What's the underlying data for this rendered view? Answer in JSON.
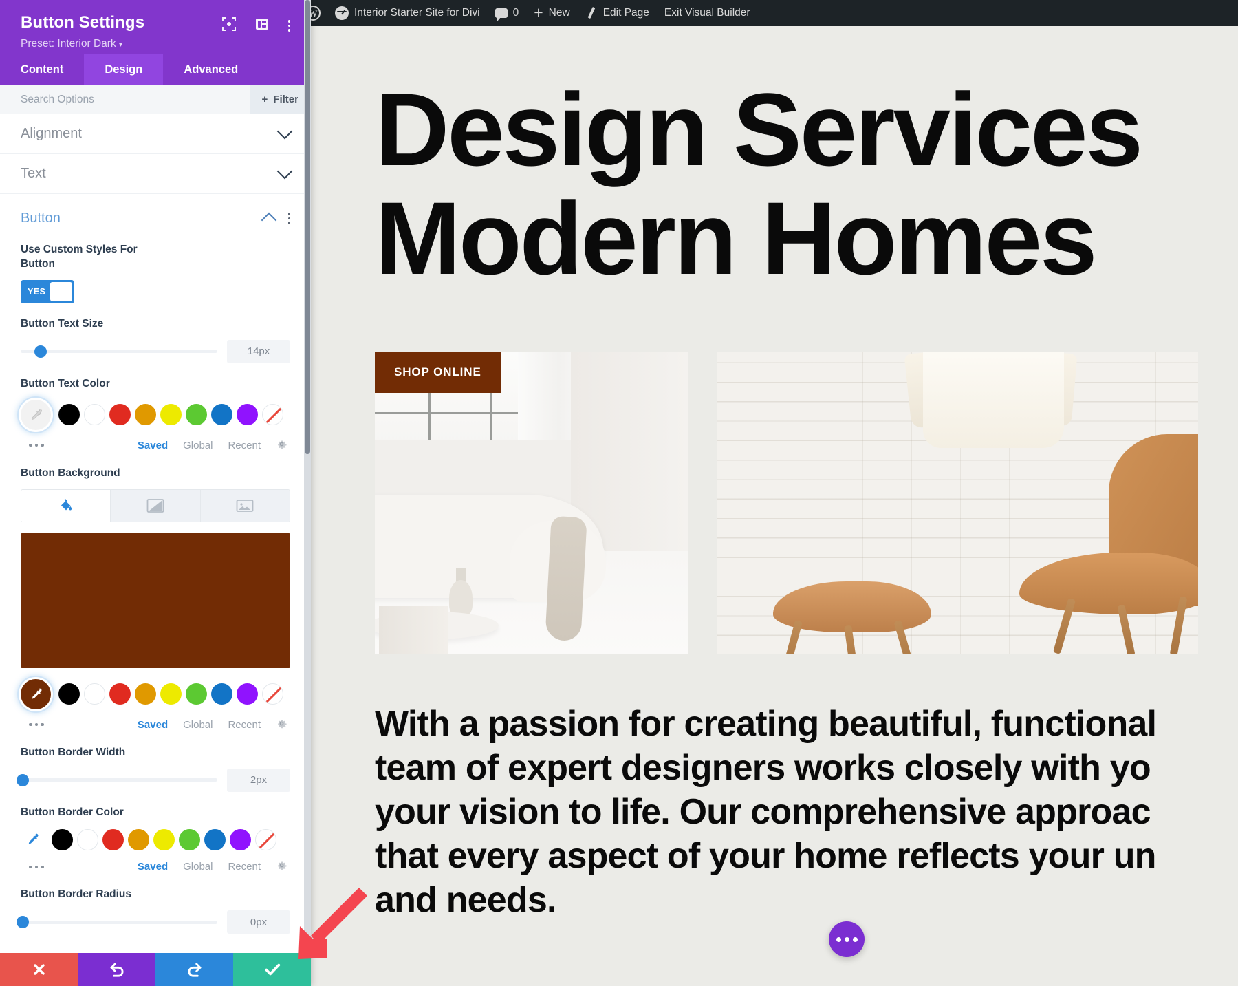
{
  "adminbar": {
    "site_name": "Interior Starter Site for Divi",
    "comment_count": "0",
    "new_label": "New",
    "edit_page_label": "Edit Page",
    "exit_label": "Exit Visual Builder"
  },
  "panel": {
    "title": "Button Settings",
    "preset_label": "Preset: Interior Dark",
    "preset_caret": "▾",
    "tabs": [
      {
        "label": "Content",
        "active": false
      },
      {
        "label": "Design",
        "active": true
      },
      {
        "label": "Advanced",
        "active": false
      }
    ],
    "search_placeholder": "Search Options",
    "search_value": "",
    "filter_label": "Filter",
    "filter_plus": "+",
    "sections": {
      "alignment": "Alignment",
      "text": "Text",
      "button": "Button"
    },
    "fields": {
      "use_custom_styles": {
        "label": "Use Custom Styles For Button",
        "toggle_value": "YES"
      },
      "button_text_size": {
        "label": "Button Text Size",
        "value": "14px",
        "knob_percent": 10
      },
      "button_text_color": {
        "label": "Button Text Color",
        "selected_color": "#f2f2f2",
        "swatches": [
          "#000000",
          "#ffffff",
          "#e02b20",
          "#e09900",
          "#edea00",
          "#5cc932",
          "#1274c6",
          "#9013fe",
          "none"
        ],
        "meta": {
          "saved": "Saved",
          "global": "Global",
          "recent": "Recent"
        }
      },
      "button_background": {
        "label": "Button Background",
        "types": [
          "color-fill-icon",
          "gradient-icon",
          "image-icon"
        ],
        "active_type": 0,
        "preview_color": "#722c05",
        "selected_color": "#722c05",
        "swatches": [
          "#000000",
          "#ffffff",
          "#e02b20",
          "#e09900",
          "#edea00",
          "#5cc932",
          "#1274c6",
          "#9013fe",
          "none"
        ],
        "meta": {
          "saved": "Saved",
          "global": "Global",
          "recent": "Recent"
        }
      },
      "button_border_width": {
        "label": "Button Border Width",
        "value": "2px",
        "knob_percent": 1
      },
      "button_border_color": {
        "label": "Button Border Color",
        "swatches": [
          "#000000",
          "#ffffff",
          "#e02b20",
          "#e09900",
          "#edea00",
          "#5cc932",
          "#1274c6",
          "#9013fe",
          "none"
        ],
        "meta": {
          "saved": "Saved",
          "global": "Global",
          "recent": "Recent"
        }
      },
      "button_border_radius": {
        "label": "Button Border Radius",
        "value": "0px",
        "knob_percent": 1
      }
    },
    "actions": {
      "cancel": "✕",
      "undo": "↺",
      "redo": "↻",
      "save": "✓"
    },
    "header_icons": [
      "fullscreen-icon",
      "layout-icon",
      "kebab-menu-icon"
    ]
  },
  "page": {
    "hero_title_line1": "Design Services",
    "hero_title_line2": "Modern Homes",
    "shop_badge": "SHOP ONLINE",
    "body_lines": [
      "With a passion for creating beautiful, functional",
      "team of expert designers works closely with yo",
      "your vision to life. Our comprehensive approac",
      "that every aspect of your home reflects your un",
      "and needs."
    ],
    "fab": "more-options-icon"
  },
  "colors": {
    "panel_purple": "#8236cc",
    "panel_purple_active": "#9145e0",
    "accent_blue": "#2b87da",
    "button_brown": "#722c05",
    "page_bg": "#ebebe7",
    "adminbar_bg": "#1d2327",
    "annotation_red": "#f44451"
  }
}
